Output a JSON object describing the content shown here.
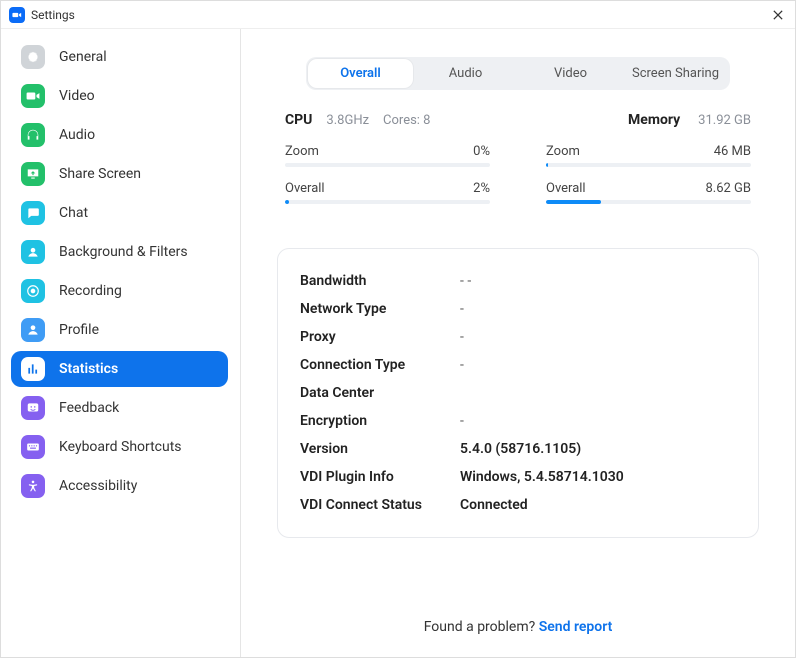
{
  "window": {
    "title": "Settings"
  },
  "sidebar": {
    "items": [
      {
        "id": "general",
        "label": "General"
      },
      {
        "id": "video",
        "label": "Video"
      },
      {
        "id": "audio",
        "label": "Audio"
      },
      {
        "id": "share-screen",
        "label": "Share Screen"
      },
      {
        "id": "chat",
        "label": "Chat"
      },
      {
        "id": "bg-filters",
        "label": "Background & Filters"
      },
      {
        "id": "recording",
        "label": "Recording"
      },
      {
        "id": "profile",
        "label": "Profile"
      },
      {
        "id": "statistics",
        "label": "Statistics"
      },
      {
        "id": "feedback",
        "label": "Feedback"
      },
      {
        "id": "shortcuts",
        "label": "Keyboard Shortcuts"
      },
      {
        "id": "accessibility",
        "label": "Accessibility"
      }
    ],
    "selected": "statistics"
  },
  "tabs": {
    "items": [
      {
        "id": "overall",
        "label": "Overall"
      },
      {
        "id": "audio",
        "label": "Audio"
      },
      {
        "id": "video",
        "label": "Video"
      },
      {
        "id": "screen",
        "label": "Screen Sharing"
      }
    ],
    "active": "overall"
  },
  "cpu": {
    "title": "CPU",
    "clock": "3.8GHz",
    "cores_label": "Cores: 8",
    "rows": [
      {
        "label": "Zoom",
        "value": "0%",
        "pct": 0
      },
      {
        "label": "Overall",
        "value": "2%",
        "pct": 2
      }
    ]
  },
  "memory": {
    "title": "Memory",
    "total": "31.92 GB",
    "rows": [
      {
        "label": "Zoom",
        "value": "46 MB",
        "pct": 1
      },
      {
        "label": "Overall",
        "value": "8.62 GB",
        "pct": 27
      }
    ]
  },
  "info": [
    {
      "k": "Bandwidth",
      "v": "-   -"
    },
    {
      "k": "Network Type",
      "v": "-"
    },
    {
      "k": "Proxy",
      "v": "-"
    },
    {
      "k": "Connection Type",
      "v": "-"
    },
    {
      "k": "Data Center",
      "v": ""
    },
    {
      "k": "Encryption",
      "v": "-"
    },
    {
      "k": "Version",
      "v": "5.4.0 (58716.1105)"
    },
    {
      "k": "VDI Plugin Info",
      "v": "Windows, 5.4.58714.1030"
    },
    {
      "k": "VDI Connect Status",
      "v": "Connected"
    }
  ],
  "footer": {
    "prompt": "Found a problem? ",
    "link": "Send report"
  }
}
